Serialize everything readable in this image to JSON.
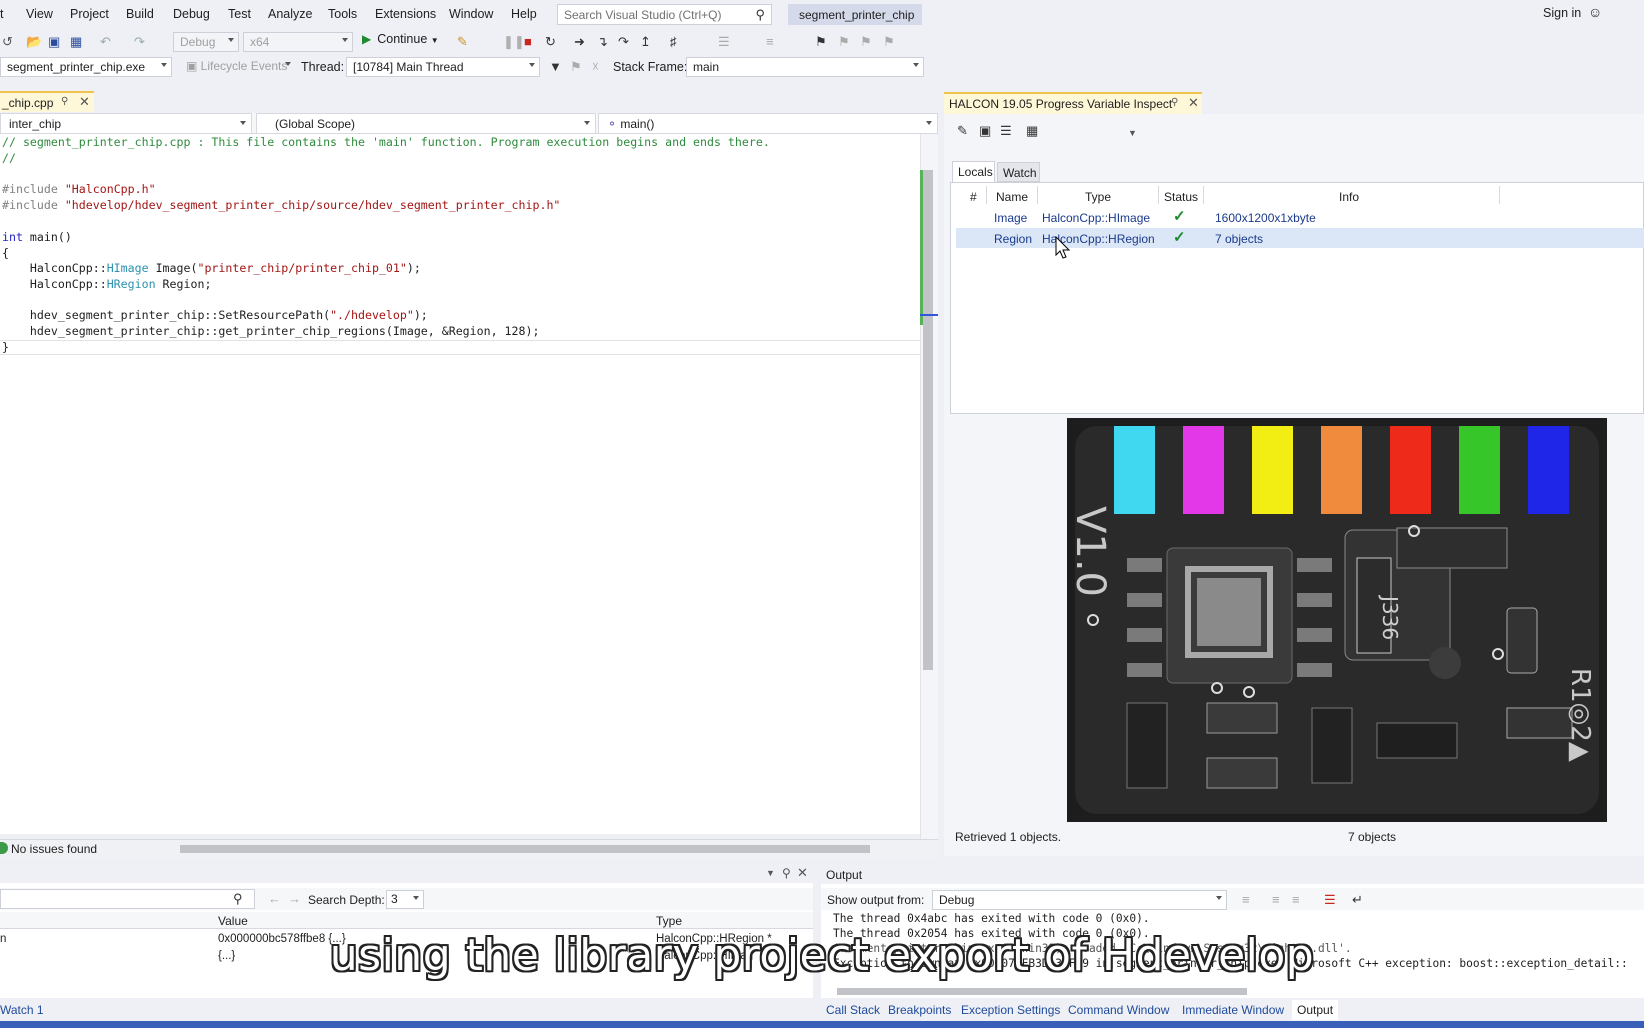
{
  "menu": {
    "items": [
      "t",
      "View",
      "Project",
      "Build",
      "Debug",
      "Test",
      "Analyze",
      "Tools",
      "Extensions",
      "Window",
      "Help"
    ],
    "search_placeholder": "Search Visual Studio (Ctrl+Q)",
    "solution_name": "segment_printer_chip",
    "sign_in": "Sign in"
  },
  "toolbar": {
    "config": "Debug",
    "platform": "x64",
    "continue_label": "Continue",
    "process": "segment_printer_chip.exe",
    "lifecycle": "Lifecycle Events",
    "thread_label": "Thread:",
    "thread_value": "[10784] Main Thread",
    "stack_frame_label": "Stack Frame:",
    "stack_frame_value": "main"
  },
  "editor": {
    "tab_label": "_chip.cpp",
    "nav_project": "inter_chip",
    "nav_scope": "(Global Scope)",
    "nav_function": "main()",
    "status": "No issues found",
    "code": {
      "line1": "// segment_printer_chip.cpp : This file contains the 'main' function. Program execution begins and ends there.",
      "line2": "//",
      "include1_directive": "#include ",
      "include1_file": "\"HalconCpp.h\"",
      "include2_directive": "#include ",
      "include2_file": "\"hdevelop/hdev_segment_printer_chip/source/hdev_segment_printer_chip.h\"",
      "main_kw": "int",
      "main_rest": " main()",
      "brace_open": "{",
      "l1_ns": "    HalconCpp::",
      "l1_type": "HImage",
      "l1_mid": " Image(",
      "l1_str": "\"printer_chip/printer_chip_01\"",
      "l1_end": ");",
      "l2_ns": "    HalconCpp::",
      "l2_type": "HRegion",
      "l2_end": " Region;",
      "l3_a": "    hdev_segment_printer_chip::SetResourcePath(",
      "l3_str": "\"./hdevelop\"",
      "l3_end": ");",
      "l4": "    hdev_segment_printer_chip::get_printer_chip_regions(Image, &Region, 128);",
      "brace_close": "}"
    }
  },
  "halcon": {
    "title": "HALCON 19.05 Progress Variable Inspect",
    "tabs": [
      "Locals",
      "Watch"
    ],
    "columns": [
      "#",
      "Name",
      "Type",
      "Status",
      "Info"
    ],
    "rows": [
      {
        "name": "Image",
        "type": "HalconCpp::HImage",
        "info": "1600x1200x1xbyte"
      },
      {
        "name": "Region",
        "type": "HalconCpp::HRegion",
        "info": "7 objects"
      }
    ],
    "retrieved": "Retrieved 1 objects.",
    "object_count": "7 objects",
    "region_colors": [
      "#40d8f0",
      "#e238e8",
      "#f2ee14",
      "#f08a3c",
      "#ee2a1a",
      "#36c62a",
      "#2026e8"
    ]
  },
  "watch": {
    "search_depth_label": "Search Depth:",
    "search_depth_value": "3",
    "columns": [
      "Value",
      "Type"
    ],
    "rows": [
      {
        "name": "n",
        "value": "0x000000bc578ffbe8 {...}",
        "type": "HalconCpp::HRegion *"
      },
      {
        "name": "",
        "value": "{...}",
        "type": "HalconCpp::HImag"
      }
    ],
    "tab_label": "Watch 1"
  },
  "output": {
    "title": "Output",
    "show_from_label": "Show output from:",
    "show_from_value": "Debug",
    "lines": [
      "The thread 0x4abc has exited with code 0 (0x0).",
      "The thread 0x2054 has exited with code 0 (0x0).",
      "'segment_printer_chip.exe' (Win32): Loaded 'C:\\Windows\\System32\\winhttp.dll'.",
      "Exception thrown at 0x00007FFB3DA34F99 in segment_printer_chip.exe: Microsoft C++ exception: boost::exception_detail::"
    ]
  },
  "bottom_tabs": [
    "Call Stack",
    "Breakpoints",
    "Exception Settings",
    "Command Window",
    "Immediate Window",
    "Output"
  ],
  "caption": "using the library project export of Hdevelop"
}
